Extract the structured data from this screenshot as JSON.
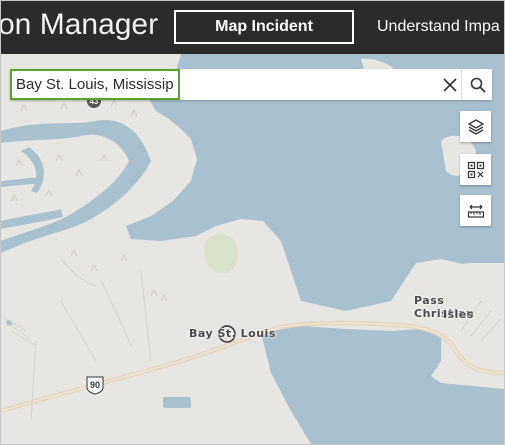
{
  "app": {
    "title": "on Manager"
  },
  "tabs": [
    {
      "label": "Map Incident",
      "active": true
    },
    {
      "label": "Understand Impa"
    }
  ],
  "search": {
    "value": "Bay St. Louis, Mississippi"
  },
  "tools": [
    {
      "icon": "layers-icon"
    },
    {
      "icon": "qr-grid-icon"
    },
    {
      "icon": "measure-icon"
    }
  ],
  "map": {
    "labels": {
      "city": "Bay St. Louis",
      "isles_line1": "Pass Christian",
      "isles_line2": "Isles"
    },
    "shields": {
      "highway": "90",
      "route": "43"
    }
  },
  "colors": {
    "water": "#a9c0cf",
    "land": "#e8e6e2",
    "road": "#e4d3bd",
    "header": "#2b2b2b",
    "search_border": "#5aa130"
  }
}
